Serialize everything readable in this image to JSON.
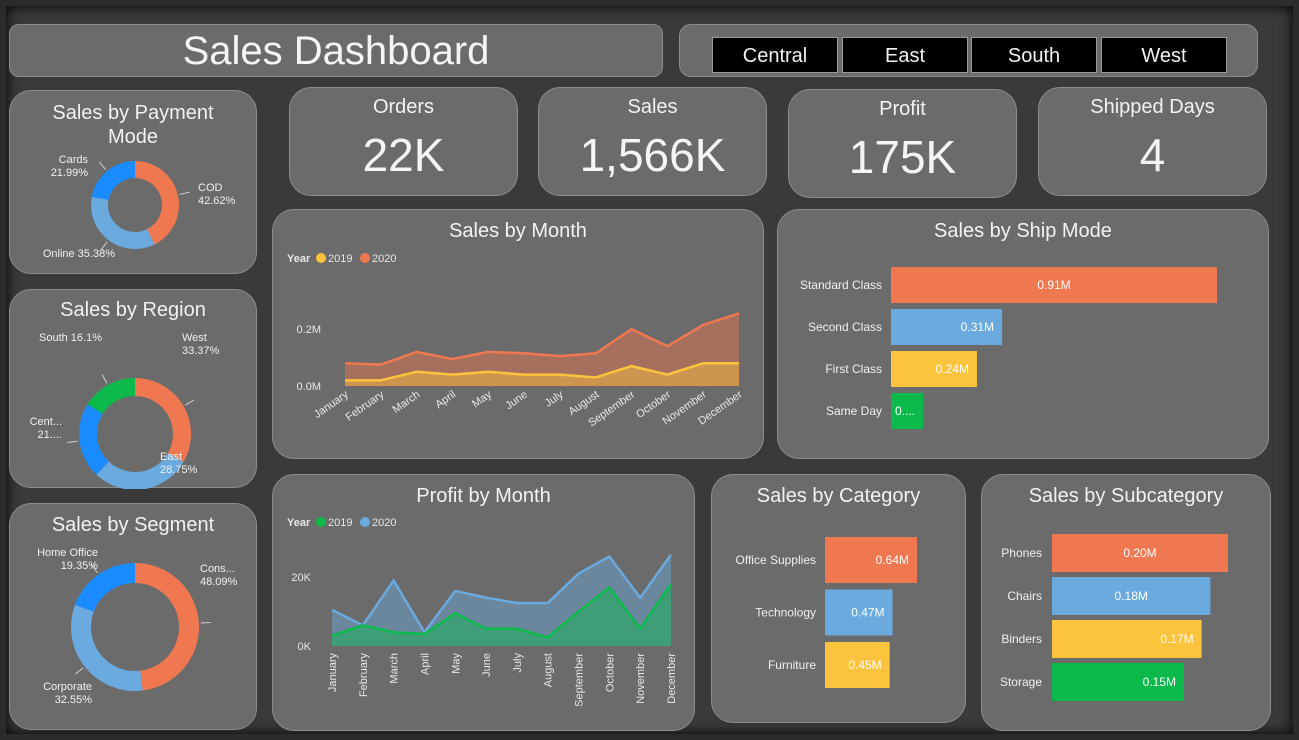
{
  "title": "Sales Dashboard",
  "region_filters": [
    "Central",
    "East",
    "South",
    "West"
  ],
  "kpis": {
    "orders": {
      "label": "Orders",
      "value": "22K"
    },
    "sales": {
      "label": "Sales",
      "value": "1,566K"
    },
    "profit": {
      "label": "Profit",
      "value": "175K"
    },
    "shipped": {
      "label": "Shipped Days",
      "value": "4"
    }
  },
  "colors": {
    "orange": "#f07850",
    "blue": "#6aaade",
    "yellow": "#fcc33d",
    "green": "#0bba4a",
    "darkblue": "#1a8cff"
  },
  "chart_data": [
    {
      "id": "payment",
      "type": "pie",
      "title": "Sales by Payment Mode",
      "slices": [
        {
          "label": "COD",
          "value": 42.62,
          "text": "42.62%",
          "color": "#f07850"
        },
        {
          "label": "Online",
          "value": 35.38,
          "text": "35.38%",
          "color": "#6aaade"
        },
        {
          "label": "Cards",
          "value": 21.99,
          "text": "21.99%",
          "color": "#1a8cff"
        }
      ]
    },
    {
      "id": "region",
      "type": "pie",
      "title": "Sales by Region",
      "slices": [
        {
          "label": "West",
          "value": 33.37,
          "text": "33.37%",
          "color": "#f07850"
        },
        {
          "label": "East",
          "value": 28.75,
          "text": "28.75%",
          "color": "#6aaade"
        },
        {
          "label": "Cent...",
          "value": 21.78,
          "text": "21....",
          "color": "#1a8cff"
        },
        {
          "label": "South",
          "value": 16.1,
          "text": "16.1%",
          "color": "#0bba4a"
        }
      ]
    },
    {
      "id": "segment",
      "type": "pie",
      "title": "Sales by Segment",
      "slices": [
        {
          "label": "Cons...",
          "value": 48.09,
          "text": "48.09%",
          "color": "#f07850"
        },
        {
          "label": "Corporate",
          "value": 32.55,
          "text": "32.55%",
          "color": "#6aaade"
        },
        {
          "label": "Home Office",
          "value": 19.35,
          "text": "19.35%",
          "color": "#1a8cff"
        }
      ]
    },
    {
      "id": "sales_month",
      "type": "area",
      "title": "Sales by Month",
      "legend_title": "Year",
      "categories": [
        "January",
        "February",
        "March",
        "April",
        "May",
        "June",
        "July",
        "August",
        "September",
        "October",
        "November",
        "December"
      ],
      "yticks": [
        "0.2M",
        "0.0M"
      ],
      "ylim": [
        0,
        0.32
      ],
      "series": [
        {
          "name": "2019",
          "color": "#fcc33d",
          "values": [
            0.02,
            0.02,
            0.05,
            0.04,
            0.05,
            0.04,
            0.04,
            0.03,
            0.07,
            0.04,
            0.08,
            0.08
          ]
        },
        {
          "name": "2020",
          "color": "#f07850",
          "values": [
            0.08,
            0.075,
            0.12,
            0.095,
            0.12,
            0.115,
            0.105,
            0.115,
            0.2,
            0.14,
            0.215,
            0.255
          ]
        }
      ]
    },
    {
      "id": "ship_mode",
      "type": "bar",
      "title": "Sales by Ship Mode",
      "categories": [
        "Standard Class",
        "Second Class",
        "First Class",
        "Same Day"
      ],
      "values": [
        0.91,
        0.31,
        0.24,
        0.09
      ],
      "labels": [
        "0.91M",
        "0.31M",
        "0.24M",
        "0...."
      ],
      "colors": [
        "#f07850",
        "#6aaade",
        "#fcc33d",
        "#0bba4a"
      ],
      "xlim": [
        0,
        0.91
      ]
    },
    {
      "id": "profit_month",
      "type": "area",
      "title": "Profit by Month",
      "legend_title": "Year",
      "categories": [
        "January",
        "February",
        "March",
        "April",
        "May",
        "June",
        "July",
        "August",
        "September",
        "October",
        "November",
        "December"
      ],
      "yticks": [
        "20K",
        "0K"
      ],
      "ylim": [
        0,
        27000
      ],
      "series": [
        {
          "name": "2019",
          "color": "#0bba4a",
          "values": [
            3000,
            6000,
            4000,
            3500,
            9500,
            5000,
            5000,
            2500,
            10000,
            17000,
            5000,
            18000
          ]
        },
        {
          "name": "2020",
          "color": "#6aaade",
          "values": [
            10500,
            6000,
            19000,
            4000,
            16000,
            14000,
            12500,
            12500,
            21000,
            26000,
            14000,
            26500
          ]
        }
      ]
    },
    {
      "id": "category",
      "type": "bar",
      "title": "Sales by Category",
      "categories": [
        "Office Supplies",
        "Technology",
        "Furniture"
      ],
      "values": [
        0.64,
        0.47,
        0.45
      ],
      "labels": [
        "0.64M",
        "0.47M",
        "0.45M"
      ],
      "colors": [
        "#f07850",
        "#6aaade",
        "#fcc33d"
      ],
      "xlim": [
        0,
        0.64
      ]
    },
    {
      "id": "subcategory",
      "type": "bar",
      "title": "Sales by Subcategory",
      "categories": [
        "Phones",
        "Chairs",
        "Binders",
        "Storage"
      ],
      "values": [
        0.2,
        0.18,
        0.17,
        0.15
      ],
      "labels": [
        "0.20M",
        "0.18M",
        "0.17M",
        "0.15M"
      ],
      "colors": [
        "#f07850",
        "#6aaade",
        "#fcc33d",
        "#0bba4a"
      ],
      "xlim": [
        0,
        0.2
      ]
    }
  ]
}
